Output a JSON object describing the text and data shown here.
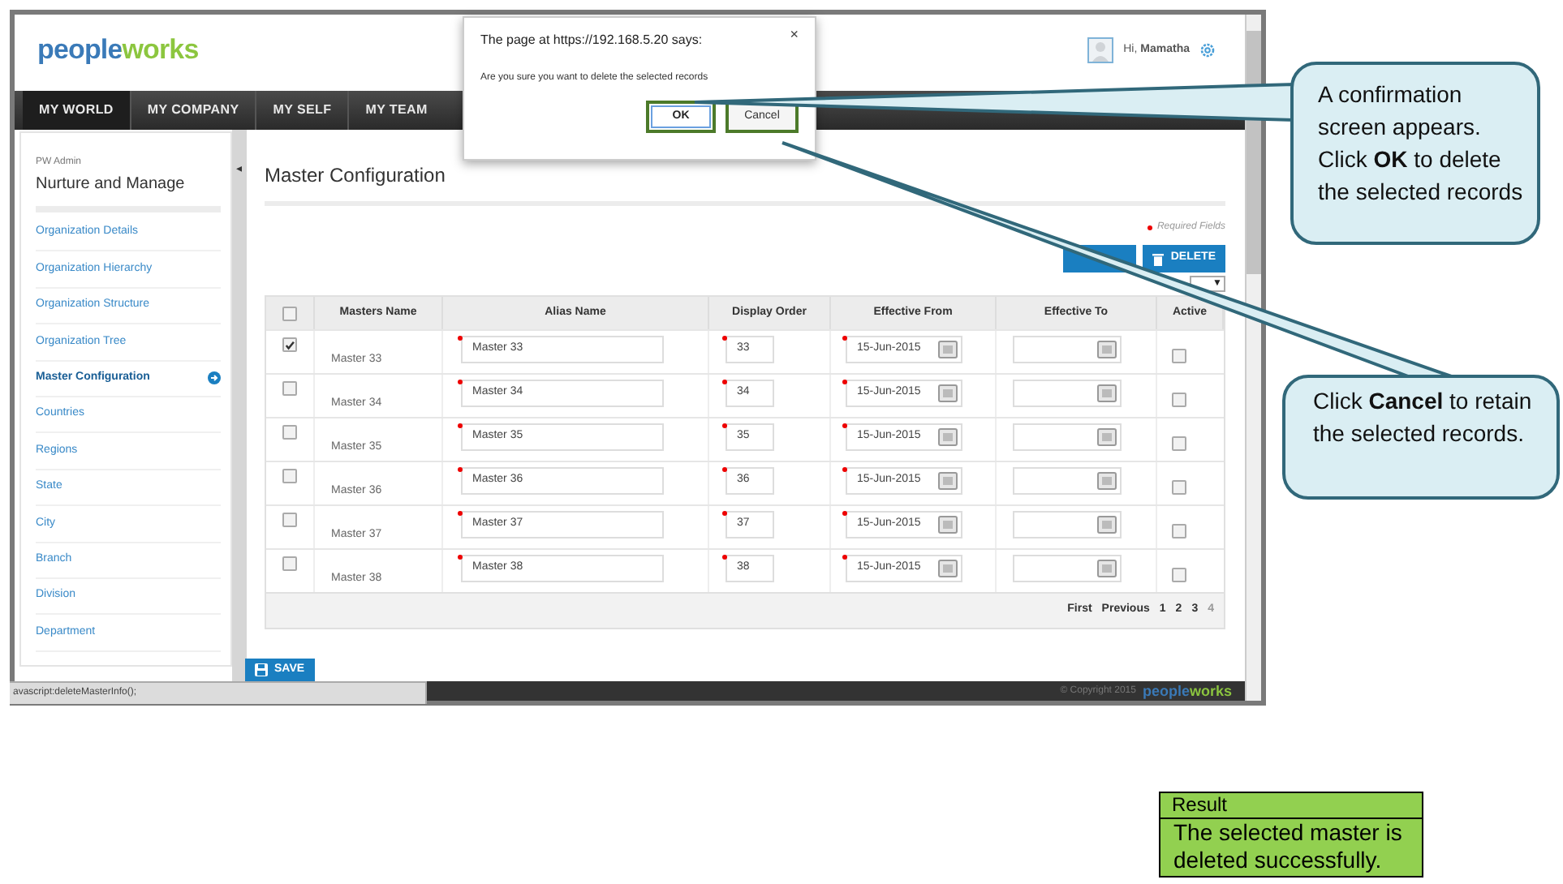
{
  "app": {
    "logo": "peopleworks",
    "user_greeting": "Hi,",
    "user_name": "Mamatha"
  },
  "nav": [
    {
      "label": "MY WORLD",
      "selected": true
    },
    {
      "label": "MY COMPANY",
      "selected": false
    },
    {
      "label": "MY SELF",
      "selected": false
    },
    {
      "label": "MY TEAM",
      "selected": false
    }
  ],
  "sidebar": {
    "caption": "PW Admin",
    "title": "Nurture and Manage",
    "items": [
      {
        "label": "Organization Details",
        "selected": false
      },
      {
        "label": "Organization Hierarchy",
        "selected": false
      },
      {
        "label": "Organization Structure",
        "selected": false
      },
      {
        "label": "Organization Tree",
        "selected": false
      },
      {
        "label": "Master Configuration",
        "selected": true
      },
      {
        "label": "Countries",
        "selected": false
      },
      {
        "label": "Regions",
        "selected": false
      },
      {
        "label": "State",
        "selected": false
      },
      {
        "label": "City",
        "selected": false
      },
      {
        "label": "Branch",
        "selected": false
      },
      {
        "label": "Division",
        "selected": false
      },
      {
        "label": "Department",
        "selected": false
      }
    ]
  },
  "collapse_arrow": "◂",
  "page_title": "Master Configuration",
  "required_note": "Required Fields",
  "delete_button": "DELETE",
  "page_size_caret": "▼",
  "table": {
    "select_all_checked": false,
    "columns": [
      "Masters Name",
      "Alias Name",
      "Display Order",
      "Effective From",
      "Effective To",
      "Active"
    ],
    "rows": [
      {
        "checked": true,
        "master": "Master 33",
        "alias": "Master 33",
        "order": "33",
        "from": "15-Jun-2015",
        "active": false
      },
      {
        "checked": false,
        "master": "Master 34",
        "alias": "Master 34",
        "order": "34",
        "from": "15-Jun-2015",
        "active": false
      },
      {
        "checked": false,
        "master": "Master 35",
        "alias": "Master 35",
        "order": "35",
        "from": "15-Jun-2015",
        "active": false
      },
      {
        "checked": false,
        "master": "Master 36",
        "alias": "Master 36",
        "order": "36",
        "from": "15-Jun-2015",
        "active": false
      },
      {
        "checked": false,
        "master": "Master 37",
        "alias": "Master 37",
        "order": "37",
        "from": "15-Jun-2015",
        "active": false
      },
      {
        "checked": false,
        "master": "Master 38",
        "alias": "Master 38",
        "order": "38",
        "from": "15-Jun-2015",
        "active": false
      }
    ],
    "pagination": [
      {
        "label": "First",
        "selected": false
      },
      {
        "label": "Previous",
        "selected": false
      },
      {
        "label": "1",
        "selected": false
      },
      {
        "label": "2",
        "selected": false
      },
      {
        "label": "3",
        "selected": false
      },
      {
        "label": "4",
        "selected": true
      }
    ]
  },
  "save_button": "SAVE",
  "status_url": "avascript:deleteMasterInfo();",
  "footer": {
    "copyright": "© Copyright 2015",
    "logo": "peopleworks"
  },
  "dialog": {
    "title": "The page at https://192.168.5.20 says:",
    "close": "×",
    "message": "Are you sure you want to delete the selected records",
    "ok": "OK",
    "cancel": "Cancel"
  },
  "callouts": [
    {
      "text": "A confirmation screen appears. Click **OK** to delete the selected records"
    },
    {
      "text": "Click **Cancel** to retain the selected records."
    }
  ],
  "result": {
    "heading": "Result",
    "text": "The selected master is deleted successfully."
  }
}
